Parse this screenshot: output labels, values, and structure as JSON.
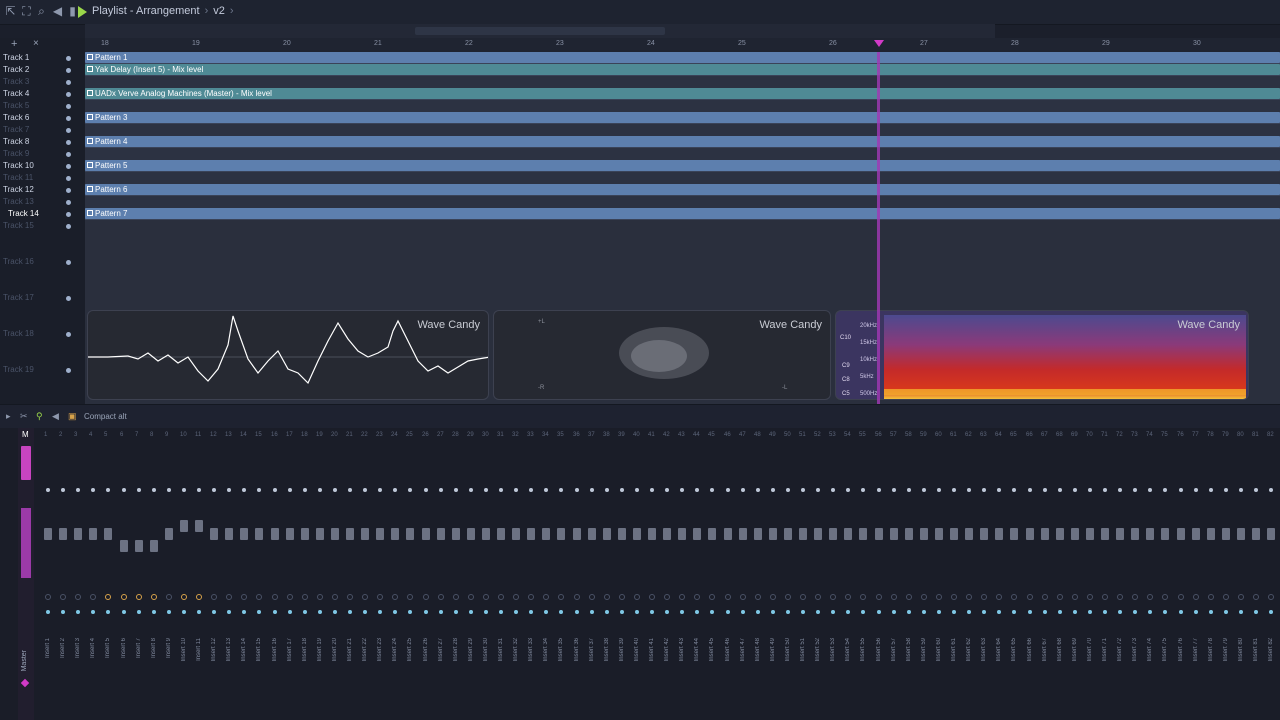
{
  "window": {
    "breadcrumb": [
      "Playlist - Arrangement",
      "v2"
    ]
  },
  "ruler": {
    "bars": [
      "18",
      "19",
      "20",
      "21",
      "22",
      "23",
      "24",
      "25",
      "26",
      "27",
      "28",
      "29",
      "30"
    ]
  },
  "tracks": [
    {
      "label": "Track 1",
      "active": true
    },
    {
      "label": "Track 2",
      "active": true
    },
    {
      "label": "Track 3",
      "active": false
    },
    {
      "label": "Track 4",
      "active": true
    },
    {
      "label": "Track 5",
      "active": false
    },
    {
      "label": "Track 6",
      "active": true
    },
    {
      "label": "Track 7",
      "active": false
    },
    {
      "label": "Track 8",
      "active": true
    },
    {
      "label": "Track 9",
      "active": false
    },
    {
      "label": "Track 10",
      "active": true
    },
    {
      "label": "Track 11",
      "active": false
    },
    {
      "label": "Track 12",
      "active": true
    },
    {
      "label": "Track 13",
      "active": false
    },
    {
      "label": "Track 14",
      "active": true
    },
    {
      "label": "Track 15",
      "active": false
    },
    {
      "label": "Track 16",
      "active": false
    },
    {
      "label": "Track 17",
      "active": false
    },
    {
      "label": "Track 18",
      "active": false
    },
    {
      "label": "Track 19",
      "active": false
    }
  ],
  "clips": [
    {
      "label": "Pattern 1",
      "type": "pattern"
    },
    {
      "label": "Yak Delay (Insert 5) - Mix level",
      "type": "automation"
    },
    {
      "label": "UADx Verve Analog Machines (Master) - Mix level",
      "type": "automation"
    },
    {
      "label": "Pattern 3",
      "type": "pattern"
    },
    {
      "label": "Pattern 4",
      "type": "pattern"
    },
    {
      "label": "Pattern 5",
      "type": "pattern"
    },
    {
      "label": "Pattern 6",
      "type": "pattern"
    },
    {
      "label": "Pattern 7",
      "type": "pattern"
    }
  ],
  "visualizers": [
    {
      "title": "Wave Candy",
      "mode": "oscilloscope"
    },
    {
      "title": "Wave Candy",
      "mode": "vectorscope",
      "labels": [
        "+L",
        "-R",
        "-L"
      ]
    },
    {
      "title": "Wave Candy",
      "mode": "spectrogram",
      "freq_labels": [
        "20kHz",
        "15kHz",
        "10kHz",
        "5kHz",
        "500Hz"
      ],
      "note_labels": [
        "C10",
        "C9",
        "C8",
        "C5"
      ]
    }
  ],
  "mixer": {
    "layout_label": "Compact alt",
    "master_label": "Master",
    "master_header": "M",
    "insert_prefix": "Insert",
    "insert_count": 83
  },
  "colors": {
    "pattern_clip": "#5d7fae",
    "automation_clip": "#4f8a95",
    "playhead": "#d23ac8",
    "accent_green": "#9bd84a"
  }
}
